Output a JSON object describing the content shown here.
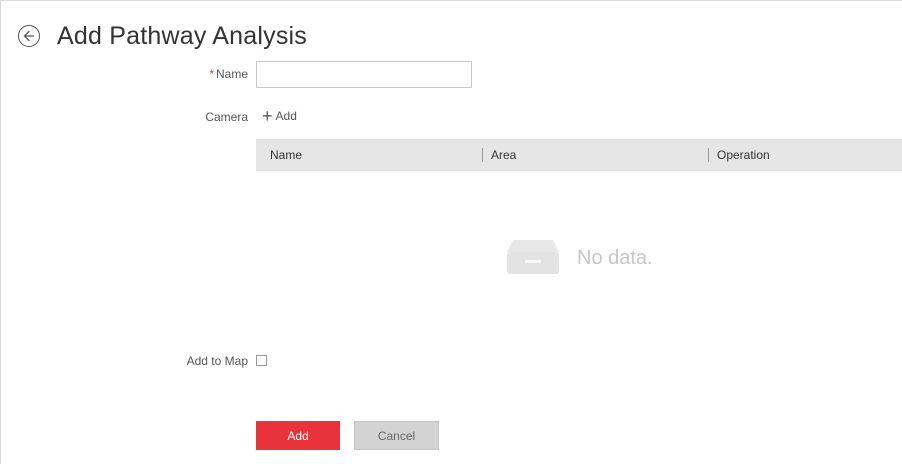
{
  "header": {
    "title": "Add Pathway Analysis"
  },
  "form": {
    "name": {
      "required_mark": "*",
      "label": "Name",
      "value": ""
    },
    "camera": {
      "label": "Camera",
      "add_label": "Add"
    },
    "add_to_map": {
      "label": "Add to Map",
      "checked": false
    }
  },
  "table": {
    "columns": [
      "Name",
      "Area",
      "Operation"
    ],
    "rows": [],
    "empty_text": "No data."
  },
  "buttons": {
    "add": "Add",
    "cancel": "Cancel"
  },
  "colors": {
    "primary": "#e8323c",
    "table_header": "#e6e6e6"
  },
  "icons": {
    "back": "back-arrow-circle-icon",
    "add": "plus-icon",
    "empty": "empty-box-icon"
  }
}
